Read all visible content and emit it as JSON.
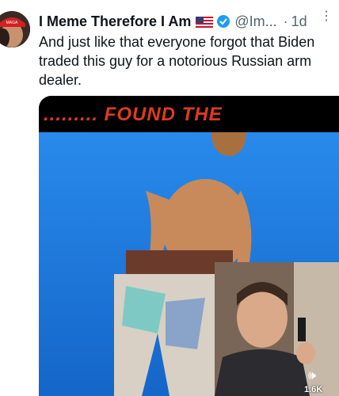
{
  "tweet": {
    "display_name": "I Meme Therefore I Am",
    "handle": "@Im...",
    "separator": "·",
    "time": "1d",
    "more": "⋮",
    "text": "And just like that everyone forgot that Biden traded this guy for a notorious Russian arm dealer."
  },
  "media": {
    "banner_text": "......... FOUND THE",
    "view_count": "1.6K",
    "mute_icon": "speaker-icon",
    "colors": {
      "sky": "#1f7fe6",
      "banner": "#000000",
      "banner_text": "#e03a1e"
    }
  }
}
